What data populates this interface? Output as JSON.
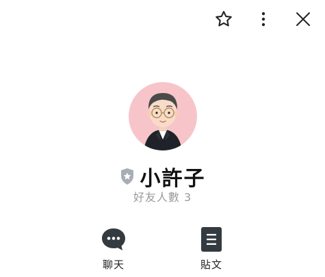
{
  "toolbar": {
    "favorite_icon": "star-outline-icon",
    "more_icon": "more-vertical-icon",
    "close_icon": "close-icon"
  },
  "profile": {
    "name": "小許子",
    "friends_count_text": "好友人數 3",
    "badge_icon": "shield-star-icon",
    "avatar_bg_color": "#f7c5c9"
  },
  "actions": [
    {
      "label": "聊天",
      "icon": "chat-bubble-icon"
    },
    {
      "label": "貼文",
      "icon": "document-icon"
    }
  ],
  "colors": {
    "icon_dark": "#333a40",
    "muted_text": "#9a9a9a",
    "badge": "#a9aeb4"
  }
}
